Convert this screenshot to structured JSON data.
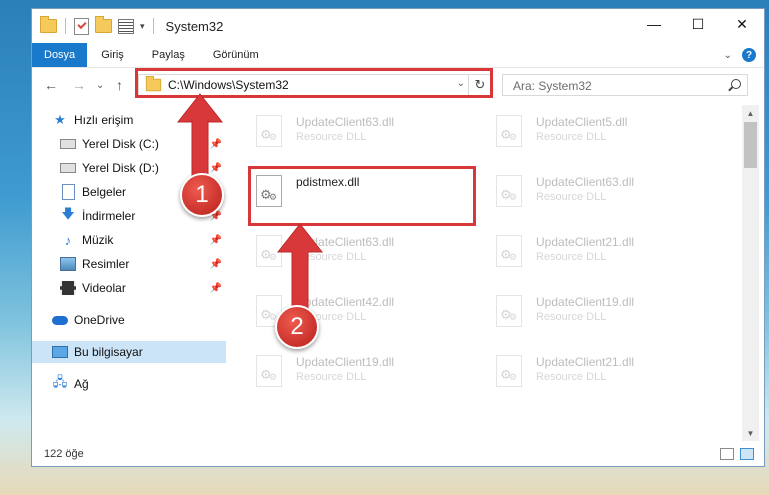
{
  "window": {
    "title": "System32",
    "controls": {
      "minimize": "—",
      "maximize": "☐",
      "close": "✕"
    }
  },
  "quick_access_toolbar": {
    "icons": [
      "folder-icon",
      "properties-check-icon",
      "folder-icon",
      "properties-icon"
    ],
    "dropdown": "▾"
  },
  "ribbon": {
    "tabs": [
      {
        "label": "Dosya",
        "active": true
      },
      {
        "label": "Giriş"
      },
      {
        "label": "Paylaş"
      },
      {
        "label": "Görünüm"
      }
    ],
    "expand": "⌄",
    "help": "?"
  },
  "address_bar": {
    "back": "←",
    "forward": "→",
    "recent": "⌄",
    "up": "↑",
    "path": "C:\\Windows\\System32",
    "dropdown": "⌄",
    "refresh": "↻"
  },
  "search": {
    "placeholder": "Ara: System32",
    "icon": "search-icon"
  },
  "sidebar": {
    "items": [
      {
        "label": "Hızlı erişim",
        "icon": "star-icon"
      },
      {
        "label": "Yerel Disk (C:)",
        "icon": "drive-icon",
        "pinned": true
      },
      {
        "label": "Yerel Disk (D:)",
        "icon": "drive-icon",
        "pinned": true
      },
      {
        "label": "Belgeler",
        "icon": "documents-icon",
        "pinned": true
      },
      {
        "label": "İndirmeler",
        "icon": "download-icon",
        "pinned": true
      },
      {
        "label": "Müzik",
        "icon": "music-icon",
        "pinned": true
      },
      {
        "label": "Resimler",
        "icon": "pictures-icon",
        "pinned": true
      },
      {
        "label": "Videolar",
        "icon": "videos-icon",
        "pinned": true
      },
      {
        "label": "OneDrive",
        "icon": "onedrive-icon"
      },
      {
        "label": "Bu bilgisayar",
        "icon": "computer-icon",
        "selected": true
      },
      {
        "label": "Ağ",
        "icon": "network-icon"
      }
    ]
  },
  "files": {
    "left": [
      {
        "name": "UpdateClient63.dll",
        "type": "Resource DLL",
        "faded": true
      },
      {
        "name": "pdistmex.dll",
        "type": "",
        "faded": false
      },
      {
        "name": "UpdateClient63.dll",
        "type": "Resource DLL",
        "faded": true
      },
      {
        "name": "UpdateClient42.dll",
        "type": "Resource DLL",
        "faded": true
      },
      {
        "name": "UpdateClient19.dll",
        "type": "Resource DLL",
        "faded": true
      }
    ],
    "right": [
      {
        "name": "UpdateClient5.dll",
        "type": "Resource DLL",
        "faded": true
      },
      {
        "name": "UpdateClient63.dll",
        "type": "Resource DLL",
        "faded": true
      },
      {
        "name": "UpdateClient21.dll",
        "type": "Resource DLL",
        "faded": true
      },
      {
        "name": "UpdateClient19.dll",
        "type": "Resource DLL",
        "faded": true
      },
      {
        "name": "UpdateClient21.dll",
        "type": "Resource DLL",
        "faded": true
      }
    ]
  },
  "status_bar": {
    "item_count": "122 öğe"
  },
  "annotations": {
    "step1": "1",
    "step2": "2",
    "color": "#d9383a"
  }
}
